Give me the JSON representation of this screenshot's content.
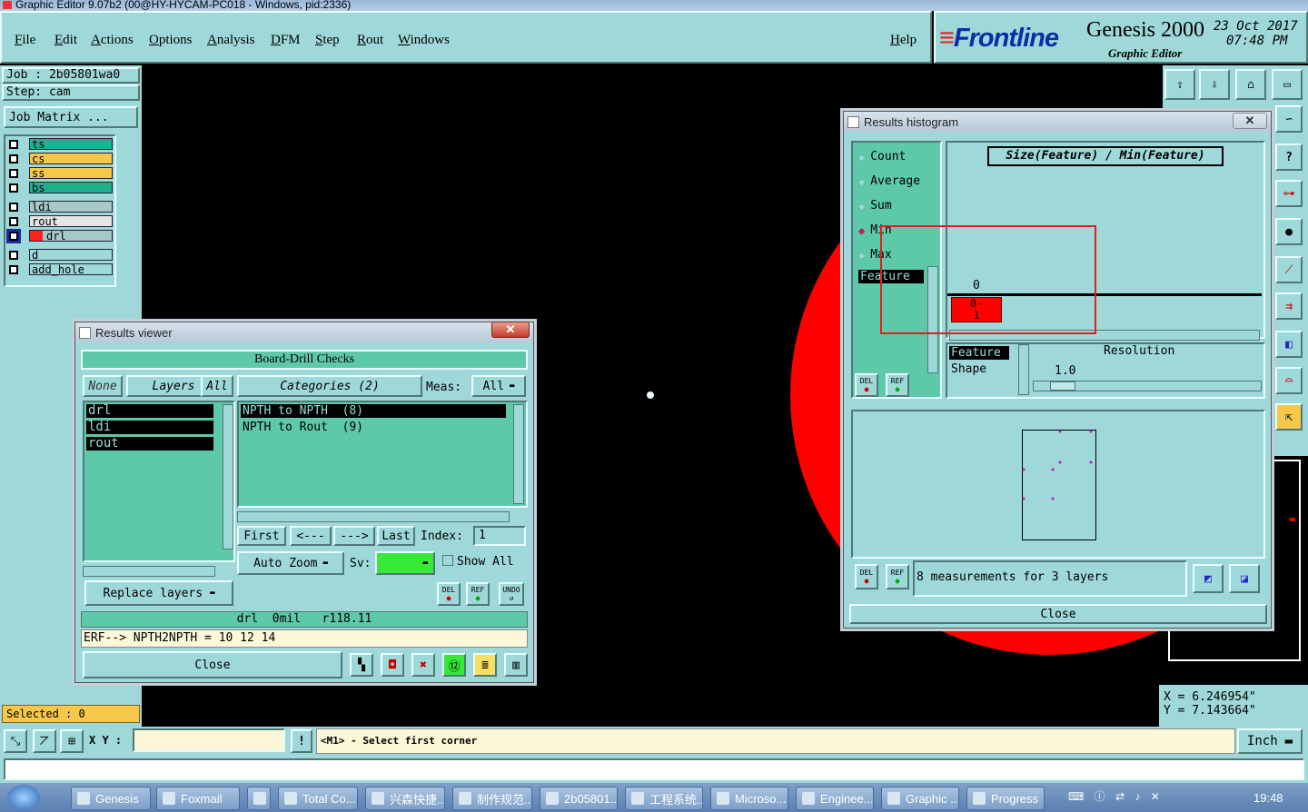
{
  "window": {
    "title": "Graphic Editor 9.07b2 (00@HY-HYCAM-PC018 - Windows, pid:2336)"
  },
  "menu": {
    "items": [
      "File",
      "Edit",
      "Actions",
      "Options",
      "Analysis",
      "DFM",
      "Step",
      "Rout",
      "Windows"
    ],
    "help": "Help"
  },
  "brand": {
    "logo": "Frontline",
    "product": "Genesis 2000",
    "subtitle": "Graphic Editor",
    "date": "23 Oct 2017",
    "time": "07:48 PM"
  },
  "job": {
    "job_label": "Job : 2b05801wa0",
    "step_label": "Step: cam",
    "matrix_button": "Job Matrix ..."
  },
  "layers": [
    {
      "name": "ts",
      "color": "#20b090"
    },
    {
      "name": "cs",
      "color": "#f7c74a"
    },
    {
      "name": "ss",
      "color": "#f7c74a"
    },
    {
      "name": "bs",
      "color": "#20b090"
    },
    {
      "name": "ldi",
      "color": "#a8c8c8"
    },
    {
      "name": "rout",
      "color": "#e6e6e6"
    },
    {
      "name": "drl",
      "color": "#a8c8c8"
    },
    {
      "name": "d",
      "color": "#9fd8d8"
    },
    {
      "name": "add_hole",
      "color": "#9fd8d8"
    }
  ],
  "selected": "Selected : 0",
  "results_viewer": {
    "title": "Results viewer",
    "header": "Board-Drill Checks",
    "filter_none": "None",
    "filter_layers": "Layers",
    "filter_all": "All",
    "layer_list": [
      "drl",
      "ldi",
      "rout"
    ],
    "categories_label": "Categories (2)",
    "meas_label": "Meas:",
    "meas_value": "All",
    "categories": [
      "NPTH to NPTH  (8)",
      "NPTH to Rout  (9)"
    ],
    "nav_first": "First",
    "nav_prev": "<---",
    "nav_next": "--->",
    "nav_last": "Last",
    "index_label": "Index:",
    "index_value": "1",
    "auto_zoom": "Auto Zoom",
    "sv_label": "Sv:",
    "show_all": "Show All",
    "replace_layers": "Replace layers",
    "del": "DEL",
    "ref": "REF",
    "undo": "UNDO",
    "info_line": "drl  0mil   r118.11",
    "erf_line": "ERF--> NPTH2NPTH = 10 12 14",
    "close": "Close"
  },
  "histogram": {
    "title": "Results histogram",
    "options": [
      "Count",
      "Average",
      "Sum",
      "Min",
      "Max"
    ],
    "selected_option": "Min",
    "chart_title": "Size(Feature) / Min(Feature)",
    "feature_item": "Feature",
    "axis_value": "0",
    "bar_label_top": "0-",
    "bar_label_bottom": "1",
    "group_list": [
      "Feature",
      "Shape"
    ],
    "resolution_label": "Resolution",
    "resolution_value": "1.0",
    "del": "DEL",
    "ref": "REF",
    "measurements": "8 measurements for 3 layers",
    "close": "Close"
  },
  "coords": {
    "x": "X = 6.246954\"",
    "y": "Y = 7.143664\""
  },
  "cmd": {
    "xy_label": "X Y :",
    "xy_value": "",
    "prompt": "<M1> - Select first corner",
    "units": "Inch"
  },
  "taskbar": {
    "items": [
      "Genesis",
      "Foxmail",
      "",
      "Total Co...",
      "兴森快捷...",
      "制作规范...",
      "2b05801...",
      "工程系统...",
      "Microso...",
      "Enginee...",
      "Graphic ...",
      "Progress"
    ],
    "clock": "19:48"
  },
  "colors": {
    "panel": "#9fd8d8",
    "list_green": "#5ec9a8",
    "pad_red": "#ff0000",
    "highlight_box": "#e02020"
  }
}
